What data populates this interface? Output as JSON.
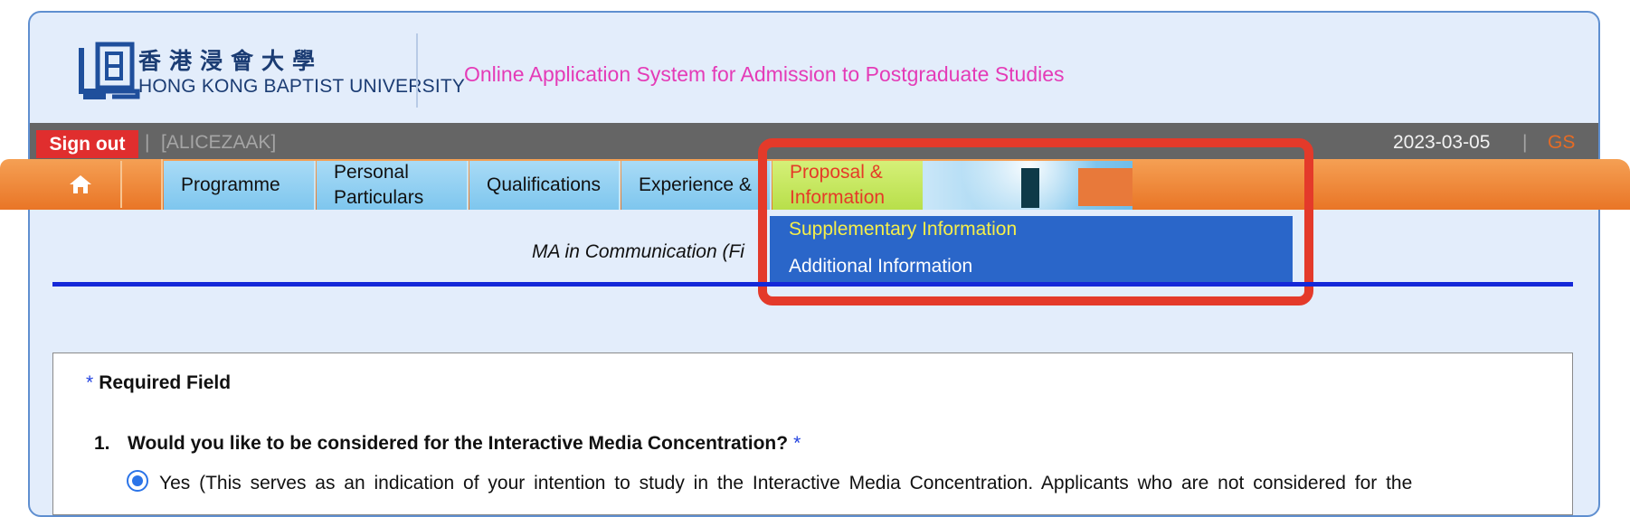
{
  "header": {
    "logo_chinese": "香港浸會大學",
    "logo_english": "HONG KONG BAPTIST UNIVERSITY",
    "system_title": "Online Application System for Admission to Postgraduate Studies"
  },
  "user_bar": {
    "signout_label": "Sign out",
    "separator": "|",
    "username": "[ALICEZAAK]",
    "date": "2023-03-05",
    "gs_label": "GS"
  },
  "nav": {
    "tabs": [
      {
        "label": "Programme"
      },
      {
        "label": "Personal Particulars"
      },
      {
        "label": "Qualifications"
      },
      {
        "label": "Experience &"
      },
      {
        "label": "Proposal & Information"
      }
    ],
    "dropdown": [
      {
        "label": "Supplementary Information"
      },
      {
        "label": "Additional Information"
      }
    ]
  },
  "main": {
    "programme_title": "MA in Communication (Fi",
    "required_star": "*",
    "required_label": "Required Field",
    "question_number": "1.",
    "question_text": "Would you like to be considered for the Interactive Media Concentration?",
    "question_star": "*",
    "option_yes": "Yes (This serves as an indication of your intention to study in the Interactive Media Concentration. Applicants who are not considered for the"
  },
  "colors": {
    "signout_bg": "#e02e2e",
    "system_title": "#e43bb7",
    "nav_orange": "#e97526",
    "active_tab": "#c7e85e",
    "dropdown_bg": "#2a66c9",
    "highlight_border": "#e43a2a"
  }
}
